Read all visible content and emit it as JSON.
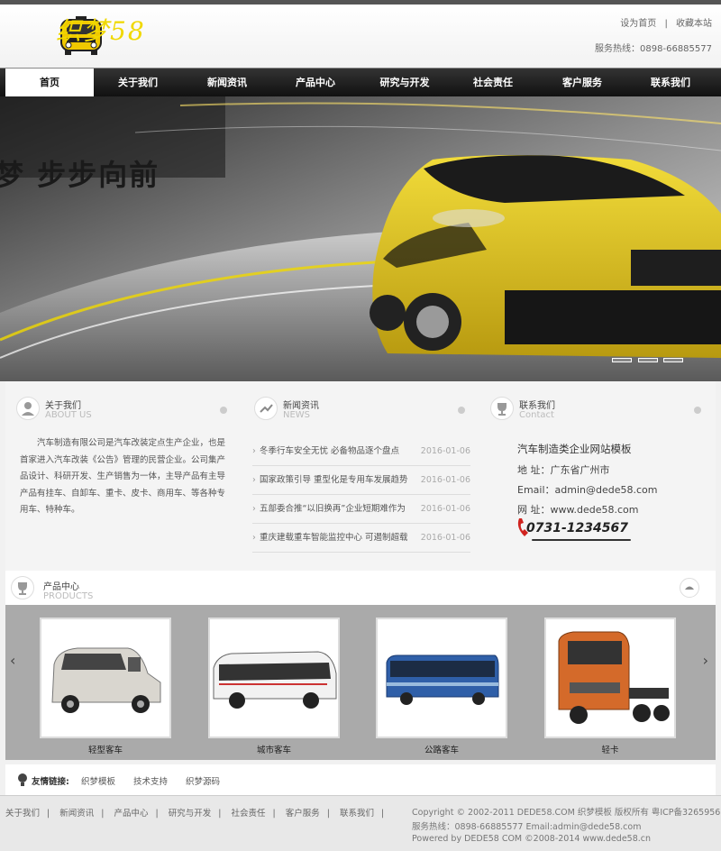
{
  "header": {
    "logo_text": "织梦58",
    "top_links": [
      "设为首页",
      "收藏本站"
    ],
    "hotline": "服务热线：0898-66885577"
  },
  "nav": {
    "items": [
      "首页",
      "关于我们",
      "新闻资讯",
      "产品中心",
      "研究与开发",
      "社会责任",
      "客户服务",
      "联系我们"
    ],
    "active": "首页"
  },
  "banner": {
    "slogan": "梦  步步向前",
    "slide_count": 3
  },
  "about": {
    "title": "关于我们",
    "subtitle": "ABOUT US",
    "text": "汽车制造有限公司是汽车改装定点生产企业，也是首家进入汽车改装《公告》管理的民营企业。公司集产品设计、科研开发、生产销售为一体，主导产品有主导产品有挂车、自卸车、重卡、皮卡、商用车、等各种专用车、特种车。"
  },
  "news": {
    "title": "新闻资讯",
    "subtitle": "NEWS",
    "items": [
      {
        "title": "冬季行车安全无忧 必备物品逐个盘点",
        "date": "2016-01-06"
      },
      {
        "title": "国家政策引导 重型化是专用车发展趋势",
        "date": "2016-01-06"
      },
      {
        "title": "五部委合推“以旧换再”企业短期难作为",
        "date": "2016-01-06"
      },
      {
        "title": "重庆建载重车智能监控中心 可遏制超载",
        "date": "2016-01-06"
      }
    ]
  },
  "contact": {
    "title": "联系我们",
    "subtitle": "Contact",
    "company": "汽车制造类企业网站模板",
    "address": "地 址：广东省广州市",
    "email": "Email：admin@dede58.com",
    "website": "网 址：www.dede58.com",
    "phone": "0731-1234567"
  },
  "products": {
    "title": "产品中心",
    "subtitle": "PRODUCTS",
    "items": [
      "轻型客车",
      "城市客车",
      "公路客车",
      "轻卡"
    ]
  },
  "links": {
    "label": "友情链接:",
    "items": [
      "织梦模板",
      "技术支持",
      "织梦源码"
    ]
  },
  "footer": {
    "nav": [
      "关于我们",
      "新闻资讯",
      "产品中心",
      "研究与开发",
      "社会责任",
      "客户服务",
      "联系我们"
    ],
    "copyright": "Copyright © 2002-2011 DEDE58.COM 织梦模板 版权所有 粤ICP备32659562",
    "service": "服务热线：0898-66885577 Email:admin@dede58.com",
    "powered": "Powered by DEDE58 COM ©2008-2014 www.dede58.cn"
  },
  "colors": {
    "accent_yellow": "#f0d800",
    "nav_bg": "#1a1a1a",
    "car_yellow": "#e6c619"
  }
}
